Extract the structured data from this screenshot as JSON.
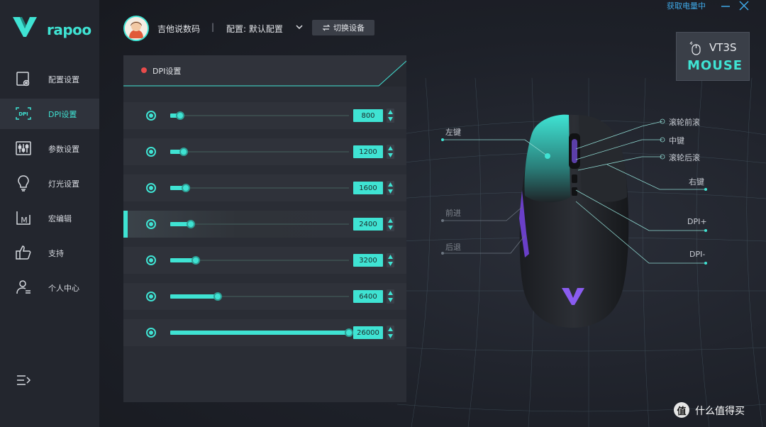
{
  "brand": {
    "name": "rapoo",
    "accent": "#3fe3d3"
  },
  "sidebar": {
    "items": [
      {
        "label": "配置设置",
        "icon": "config-icon"
      },
      {
        "label": "DPI设置",
        "icon": "dpi-icon",
        "active": true
      },
      {
        "label": "参数设置",
        "icon": "params-icon"
      },
      {
        "label": "灯光设置",
        "icon": "lightbulb-icon"
      },
      {
        "label": "宏编辑",
        "icon": "macro-icon"
      },
      {
        "label": "支持",
        "icon": "thumbs-up-icon"
      },
      {
        "label": "个人中心",
        "icon": "user-icon"
      }
    ],
    "collapse_icon": "collapse-menu-icon"
  },
  "topbar": {
    "username": "吉他说数码",
    "separator": "|",
    "config_label": "配置: 默认配置",
    "switch_device": "切换设备",
    "status": "获取电量中"
  },
  "device": {
    "model": "VT3S",
    "type": "MOUSE"
  },
  "dpi_panel": {
    "title": "DPI设置",
    "status_color": "#e84b4b",
    "levels": [
      {
        "value": "800",
        "fraction": 0.056
      },
      {
        "value": "1200",
        "fraction": 0.074
      },
      {
        "value": "1600",
        "fraction": 0.088
      },
      {
        "value": "2400",
        "fraction": 0.115,
        "active": true
      },
      {
        "value": "3200",
        "fraction": 0.143
      },
      {
        "value": "6400",
        "fraction": 0.265
      },
      {
        "value": "26000",
        "fraction": 1.0
      }
    ]
  },
  "mouse_buttons": {
    "left_click": "左键",
    "forward": "前进",
    "back": "后退",
    "scroll_forward": "滚轮前滚",
    "middle_click": "中键",
    "scroll_back": "滚轮后滚",
    "right_click": "右键",
    "dpi_plus": "DPI+",
    "dpi_minus": "DPI-"
  },
  "watermark": {
    "badge": "值",
    "text": "什么值得买"
  }
}
